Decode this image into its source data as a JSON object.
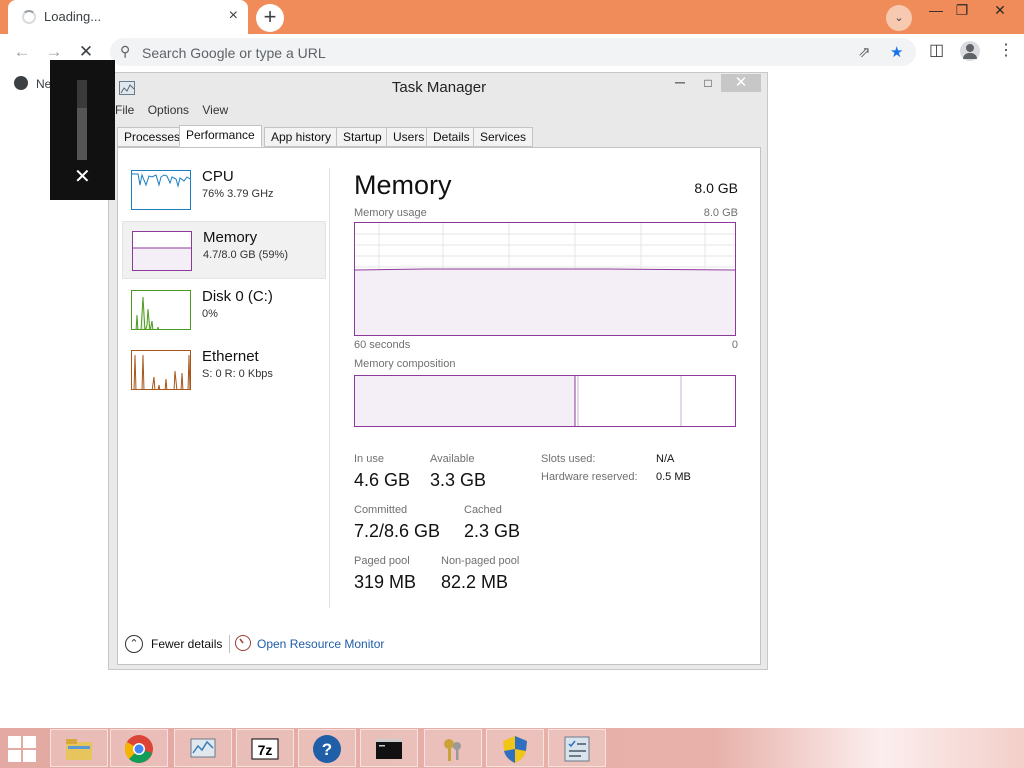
{
  "browser": {
    "tab_title": "Loading...",
    "tab_close": "×",
    "new_tab": "+",
    "tab_search": "⌄",
    "win_minimize": "—",
    "win_restore": "❐",
    "win_close": "✕",
    "omnibox_placeholder": "Search Google or type a URL",
    "bookmark_partial": "Ne"
  },
  "task_manager": {
    "title": "Task Manager",
    "close_glyph": "✕",
    "menu": [
      "File",
      "Options",
      "View"
    ],
    "tabs": [
      "Processes",
      "Performance",
      "App history",
      "Startup",
      "Users",
      "Details",
      "Services"
    ],
    "active_tab": "Performance",
    "sidebar": [
      {
        "name": "CPU",
        "sub": "76%  3.79 GHz",
        "color": "#1a7fbf"
      },
      {
        "name": "Memory",
        "sub": "4.7/8.0 GB (59%)",
        "color": "#8c3a9a"
      },
      {
        "name": "Disk 0 (C:)",
        "sub": "0%",
        "color": "#4d9a1f"
      },
      {
        "name": "Ethernet",
        "sub": "S: 0  R: 0 Kbps",
        "color": "#a7561b"
      }
    ],
    "memory": {
      "title": "Memory",
      "total": "8.0 GB",
      "usage_label": "Memory usage",
      "usage_max": "8.0 GB",
      "time_left": "60 seconds",
      "time_right": "0",
      "composition_label": "Memory composition",
      "stats": {
        "in_use_label": "In use",
        "in_use": "4.6 GB",
        "available_label": "Available",
        "available": "3.3 GB",
        "committed_label": "Committed",
        "committed": "7.2/8.6 GB",
        "cached_label": "Cached",
        "cached": "2.3 GB",
        "paged_label": "Paged pool",
        "paged": "319 MB",
        "nonpaged_label": "Non-paged pool",
        "nonpaged": "82.2 MB"
      },
      "details": {
        "slots_label": "Slots used:",
        "slots": "N/A",
        "reserved_label": "Hardware reserved:",
        "reserved": "0.5 MB"
      }
    },
    "footer": {
      "fewer_details": "Fewer details",
      "open_resource_monitor": "Open Resource Monitor"
    },
    "accent_memory": "#8c3a9a"
  },
  "taskbar": {
    "items": [
      "file-explorer",
      "chrome",
      "task-manager",
      "7zip",
      "help",
      "command-prompt",
      "keys",
      "security-shield",
      "control-panel"
    ]
  },
  "volume_overlay": {
    "close": "✕",
    "level": 0.65
  }
}
